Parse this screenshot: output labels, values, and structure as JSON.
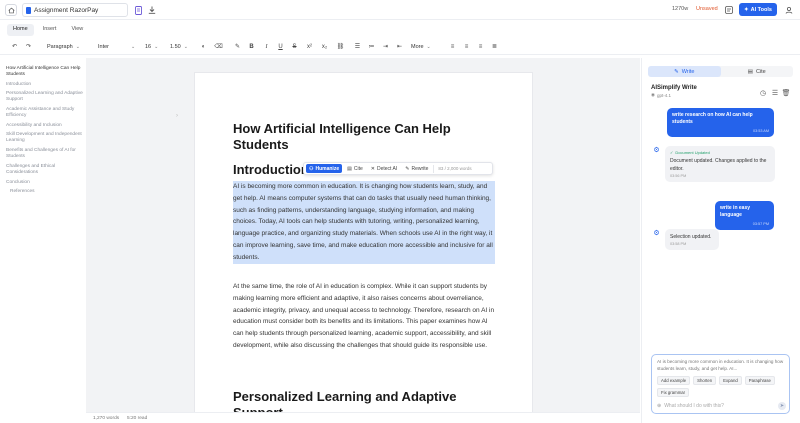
{
  "topbar": {
    "doc_title": "Assignment RazorPay",
    "word_count": "1270w",
    "unsaved": "Unsaved",
    "ai_tools_label": "AI Tools"
  },
  "tabs": [
    "Home",
    "Insert",
    "View"
  ],
  "toolbar": {
    "style": "Paragraph",
    "font": "Inter",
    "size": "16",
    "line_height": "1.50",
    "more": "More"
  },
  "outline": [
    "How Artificial Intelligence Can Help Students",
    "Introduction",
    "Personalized Learning and Adaptive Support",
    "Academic Assistance and Study Efficiency",
    "Accessibility and Inclusion",
    "Skill Development and Independent Learning",
    "Benefits and Challenges of AI for Students",
    "Challenges and Ethical Considerations",
    "Conclusion",
    "References"
  ],
  "document": {
    "title": "How Artificial Intelligence Can Help Students",
    "intro_heading": "Introduction",
    "para1": "AI is becoming more common in education. It is changing how students learn, study, and get help. AI means computer systems that can do tasks that usually need human thinking, such as finding patterns, understanding language, studying information, and making choices. Today, AI tools can help students with tutoring, writing, personalized learning, language practice, and organizing study materials. When schools use AI in the right way, it can improve learning, save time, and make education more accessible and inclusive for all students.",
    "para2": "At the same time, the role of AI in education is complex. While it can support students by making learning more efficient and adaptive, it also raises concerns about overreliance, academic integrity, privacy, and unequal access to technology. Therefore, research on AI in education must consider both its benefits and its limitations. This paper examines how AI can help students through personalized learning, academic support, accessibility, and skill development, while also discussing the challenges that should guide its responsible use.",
    "section2_heading": "Personalized Learning and Adaptive Support"
  },
  "popup": {
    "humanize": "Humanize",
    "cite": "Cite",
    "detect": "Detect AI",
    "rewrite": "Rewrite",
    "count": "83 / 2,000 words"
  },
  "status": {
    "words": "1,270 words",
    "read_time": "5:20 read"
  },
  "panel": {
    "tab_write": "Write",
    "tab_cite": "Cite",
    "title": "AISimplify Write",
    "model": "gpt-4.1",
    "messages": [
      {
        "role": "user",
        "text": "write research on how AI can help students",
        "time": "03:53 AM"
      },
      {
        "role": "ai",
        "label": "Document Updated",
        "text": "Document updated. Changes applied to the editor.",
        "time": "03:56 PM"
      },
      {
        "role": "user",
        "text": "write in easy language",
        "time": "03:57 PM"
      },
      {
        "role": "ai",
        "text": "Selection updated.",
        "time": "03:58 PM"
      }
    ],
    "composer": {
      "quote": "AI is becoming more common in education. It is changing how students learn, study, and get help. AI...",
      "chips": [
        "Add example",
        "Shorten",
        "Expand",
        "Paraphrase",
        "Fix grammar"
      ],
      "placeholder": "What should I do with this?"
    }
  },
  "colors": {
    "accent": "#2563eb",
    "selection": "#cfe0fa",
    "unsaved": "#e0582d"
  }
}
